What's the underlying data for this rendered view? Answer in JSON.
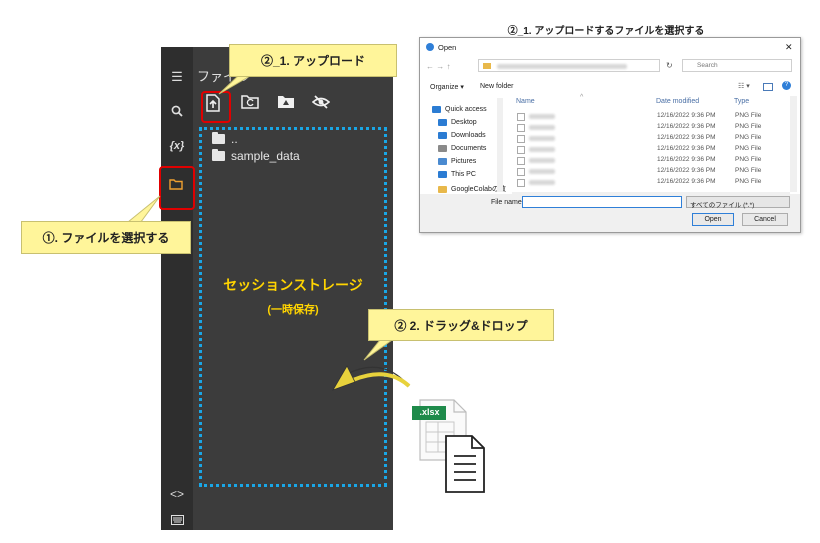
{
  "colab": {
    "panel_title": "ファイル",
    "storage_title": "セッションストレージ",
    "storage_subtitle": "(一時保存)",
    "tree": [
      {
        "name": ".."
      },
      {
        "name": "sample_data"
      }
    ],
    "icons": {
      "toc": "menu-icon",
      "search": "search-icon",
      "variables": "variables-icon",
      "files": "folder-icon",
      "code": "code-icon",
      "terminal": "terminal-icon"
    },
    "variables_label": "{x}",
    "code_label": "<>"
  },
  "callouts": {
    "select_files": "①. ファイルを選択する",
    "upload": "②_1. アップロード",
    "drag_drop": "② 2. ドラッグ&ドロップ"
  },
  "file_badge": ".xlsx",
  "dialog": {
    "caption": "②_1. アップロードするファイルを選択する",
    "title": "Open",
    "search_placeholder": "Search",
    "organize": "Organize ▾",
    "new_folder": "New folder",
    "columns": {
      "name": "Name",
      "date": "Date modified",
      "type": "Type"
    },
    "nav": [
      {
        "label": "Quick access",
        "icon": "star-icon",
        "color": "#2b7cd3"
      },
      {
        "label": "Desktop",
        "icon": "desktop-icon",
        "color": "#2b7cd3"
      },
      {
        "label": "Downloads",
        "icon": "download-icon",
        "color": "#2b7cd3"
      },
      {
        "label": "Documents",
        "icon": "documents-icon",
        "color": "#8a8a8a"
      },
      {
        "label": "Pictures",
        "icon": "pictures-icon",
        "color": "#4a8ad0"
      },
      {
        "label": "This PC",
        "icon": "pc-icon",
        "color": "#2b7cd3"
      },
      {
        "label": "GoogleColabの教",
        "icon": "folder-icon",
        "color": "#e8b84a"
      }
    ],
    "files": [
      {
        "date": "12/16/2022 9:36 PM",
        "type": "PNG File"
      },
      {
        "date": "12/16/2022 9:36 PM",
        "type": "PNG File"
      },
      {
        "date": "12/16/2022 9:36 PM",
        "type": "PNG File"
      },
      {
        "date": "12/16/2022 9:36 PM",
        "type": "PNG File"
      },
      {
        "date": "12/16/2022 9:36 PM",
        "type": "PNG File"
      },
      {
        "date": "12/16/2022 9:36 PM",
        "type": "PNG File"
      },
      {
        "date": "12/16/2022 9:36 PM",
        "type": "PNG File"
      }
    ],
    "file_name_label": "File name:",
    "file_type": "すべてのファイル (*.*)",
    "open": "Open",
    "cancel": "Cancel",
    "close_glyph": "✕"
  },
  "accent_colors": {
    "callout_bg": "#fff59a",
    "highlight": "#e00000",
    "dotted": "#19a6e6",
    "storage_text": "#ffd400"
  }
}
